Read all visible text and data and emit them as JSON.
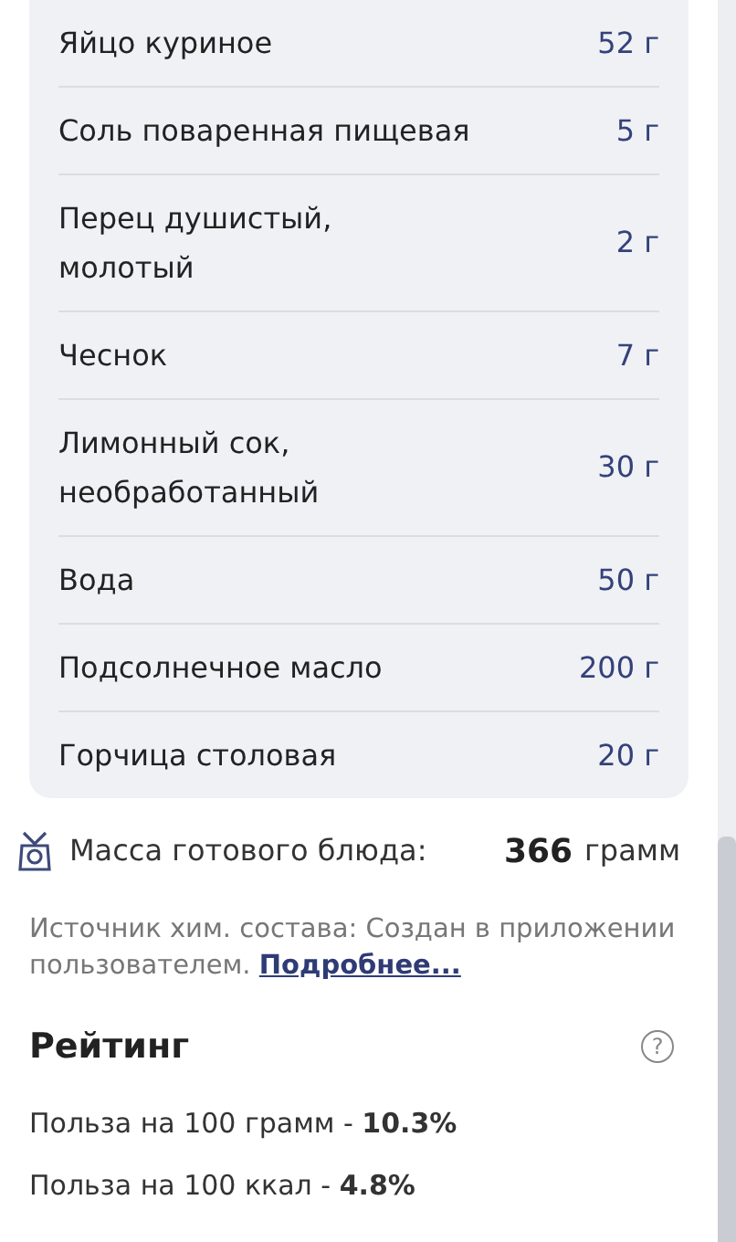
{
  "ingredients": [
    {
      "name_lines": [
        "Яйцо куриное"
      ],
      "amount": "52 г"
    },
    {
      "name_lines": [
        "Соль поваренная пищевая"
      ],
      "amount": "5 г"
    },
    {
      "name_lines": [
        "Перец душистый,",
        "молотый"
      ],
      "amount": "2 г"
    },
    {
      "name_lines": [
        "Чеснок"
      ],
      "amount": "7 г"
    },
    {
      "name_lines": [
        "Лимонный сок,",
        "необработанный"
      ],
      "amount": "30 г"
    },
    {
      "name_lines": [
        "Вода"
      ],
      "amount": "50 г"
    },
    {
      "name_lines": [
        "Подсолнечное масло"
      ],
      "amount": "200 г"
    },
    {
      "name_lines": [
        "Горчица столовая"
      ],
      "amount": "20 г"
    }
  ],
  "dish_mass": {
    "label": "Масса готового блюда:",
    "value": "366",
    "unit": "грамм"
  },
  "source": {
    "text": "Источник хим. состава: Создан в приложении пользователем.",
    "link": "Подробнее..."
  },
  "rating": {
    "title": "Рейтинг",
    "help": "?",
    "lines": [
      "Польза на 100 грамм - **10.3%**",
      "Польза на 100 ккал - **4.8%**"
    ]
  }
}
